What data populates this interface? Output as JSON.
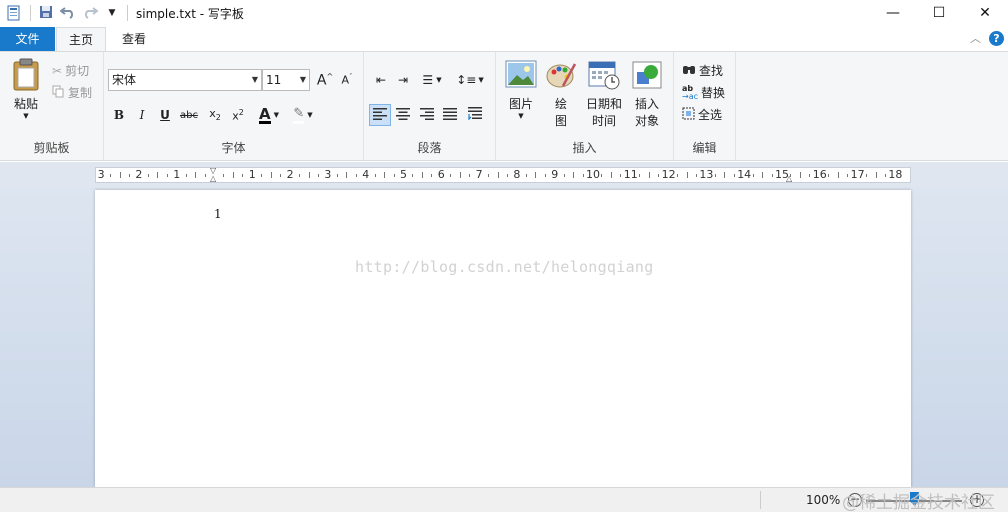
{
  "window": {
    "title": "simple.txt - 写字板",
    "minimize": "—",
    "maximize": "☐",
    "close": "✕"
  },
  "tabs": {
    "file": "文件",
    "home": "主页",
    "view": "查看",
    "help": "?"
  },
  "clipboard": {
    "paste": "粘贴",
    "cut": "剪切",
    "copy": "复制",
    "label": "剪贴板"
  },
  "font": {
    "family": "宋体",
    "size": "11",
    "label": "字体"
  },
  "paragraph": {
    "label": "段落"
  },
  "insert": {
    "picture": "图片",
    "paint_line1": "绘",
    "paint_line2": "图",
    "datetime_line1": "日期和",
    "datetime_line2": "时间",
    "object_line1": "插入",
    "object_line2": "对象",
    "label": "插入"
  },
  "editing": {
    "find": "查找",
    "replace": "替换",
    "select_all": "全选",
    "label": "编辑"
  },
  "ruler": {
    "numbers": [
      "3",
      "2",
      "1",
      "",
      "1",
      "2",
      "3",
      "4",
      "5",
      "6",
      "7",
      "8",
      "9",
      "10",
      "11",
      "12",
      "13",
      "14",
      "15",
      "16",
      "17",
      "18"
    ]
  },
  "document": {
    "text": "1",
    "watermark": "http://blog.csdn.net/helongqiang"
  },
  "status": {
    "zoom": "100%",
    "site_watermark": "@稀土掘金技术社区"
  },
  "colors": {
    "accent": "#1979ca",
    "ribbon_bg": "#f5f6f7",
    "doc_bg": "#dde5f0"
  }
}
